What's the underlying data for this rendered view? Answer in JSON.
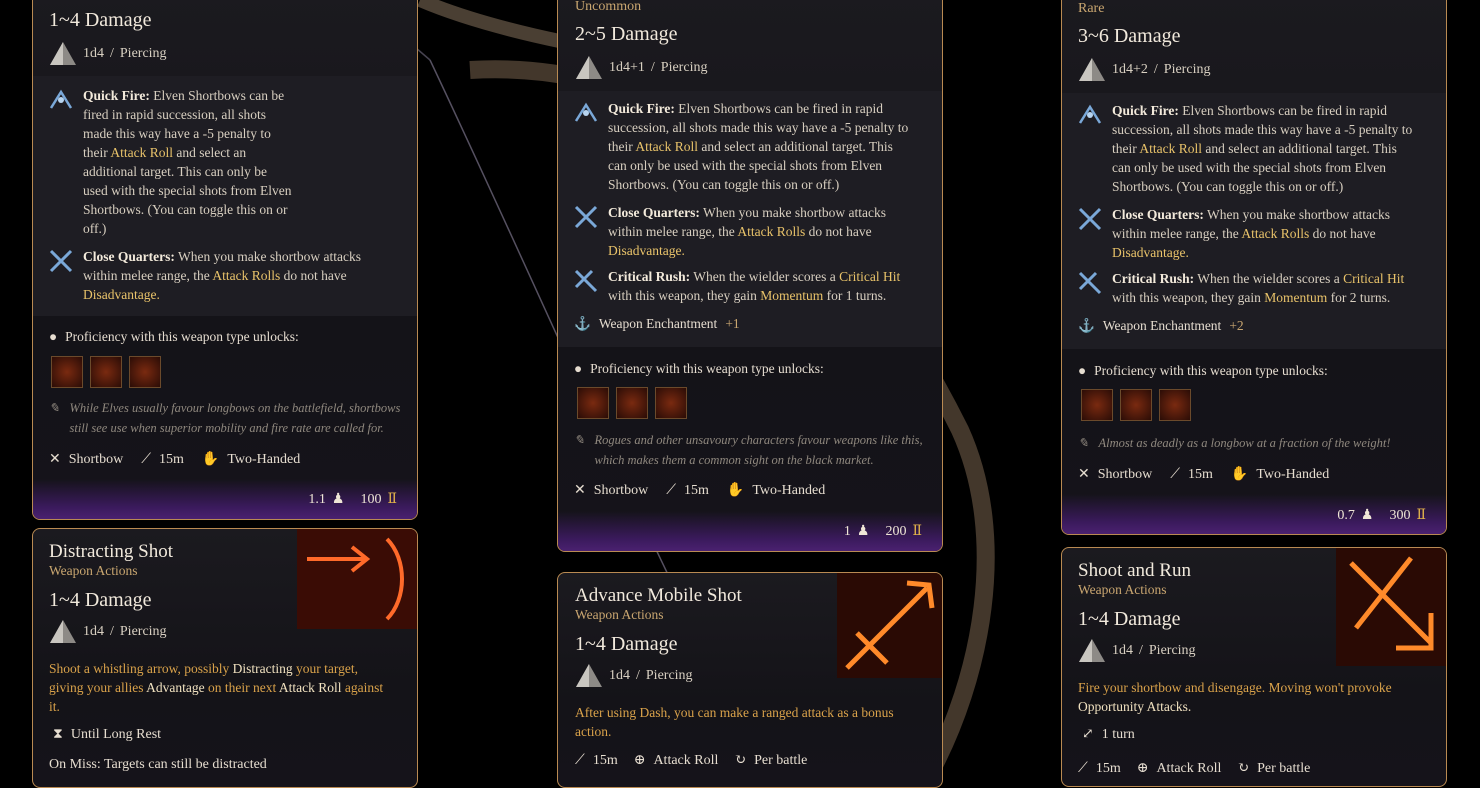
{
  "labels": {
    "damage_type": "Piercing",
    "proficiency": "Proficiency with this weapon type unlocks:",
    "shortbow": "Shortbow",
    "range": "15m",
    "two_handed": "Two-Handed",
    "weapon_actions": "Weapon Actions",
    "attack_roll": "Attack Roll",
    "per_battle": "Per battle"
  },
  "left_card": {
    "damage": "1~4 Damage",
    "dice": "1d4",
    "quick_fire_title": "Quick Fire:",
    "quick_fire_lines": [
      "Elven Shortbows can be",
      "fired in rapid succession, all shots",
      "made this way have a -5 penalty to",
      "their",
      "and select an",
      "additional target. This can only be",
      "used with the special shots from Elven",
      "Shortbows. (You can toggle this on or",
      "off.)"
    ],
    "attack_roll_link": "Attack Roll",
    "close_quarters_title": "Close Quarters:",
    "close_quarters_lines": [
      "When you make shortbow attacks",
      "within melee range, the",
      "do not have"
    ],
    "attack_rolls_link": "Attack Rolls",
    "disadvantage_link": "Disadvantage.",
    "flavor": [
      "While Elves usually favour longbows on the battlefield, shortbows",
      "still see use when superior mobility and fire rate are called for."
    ],
    "weight": "1.1",
    "value": "100"
  },
  "middle_card": {
    "rarity": "Uncommon",
    "damage": "2~5 Damage",
    "dice": "1d4+1",
    "qf_lines": [
      "Elven Shortbows can be fired in rapid",
      "succession, all shots made this way have a -5 penalty to",
      "their",
      "and select an additional target. This",
      "can only be used with the special shots from Elven",
      "Shortbows. (You can toggle this on or off.)"
    ],
    "cq_lines": [
      "When you make shortbow attacks",
      "within melee range, the",
      "do not have"
    ],
    "critical_rush_title": "Critical Rush:",
    "cr_lines": [
      "When the wielder scores a",
      "with this weapon, they gain",
      "for 1 turns."
    ],
    "critical_hit_link": "Critical Hit",
    "momentum_link": "Momentum",
    "enchant_label": "Weapon Enchantment",
    "enchant_value": "+1",
    "flavor": [
      "Rogues and other unsavoury characters favour weapons like this,",
      "which makes them a common sight on the black market."
    ],
    "weight": "1",
    "value": "200"
  },
  "right_card": {
    "rarity": "Rare",
    "damage": "3~6 Damage",
    "dice": "1d4+2",
    "cr_tail": "for 2 turns.",
    "enchant_value": "+2",
    "flavor": [
      "Almost as deadly as a longbow at a fraction of the weight!"
    ],
    "weight": "0.7",
    "value": "300"
  },
  "action_left": {
    "title": "Distracting Shot",
    "damage": "1~4 Damage",
    "dice": "1d4",
    "desc_lines": [
      "Shoot a whistling arrow, possibly",
      "your target,",
      "giving your allies",
      "on their next",
      "against",
      "it."
    ],
    "distracting": "Distracting",
    "advantage": "Advantage",
    "attack_roll": "Attack Roll",
    "duration": "Until Long Rest",
    "on_miss": "On Miss: Targets can still be distracted"
  },
  "action_mid": {
    "title": "Advance Mobile Shot",
    "damage": "1~4 Damage",
    "dice": "1d4",
    "desc_lines": [
      "After using Dash, you can make a ranged attack as a bonus",
      "action."
    ]
  },
  "action_right": {
    "title": "Shoot and Run",
    "damage": "1~4 Damage",
    "dice": "1d4",
    "desc_lines": [
      "Fire your shortbow and disengage. Moving won't provoke",
      "Opportunity Attacks."
    ],
    "turns": "1 turn"
  }
}
